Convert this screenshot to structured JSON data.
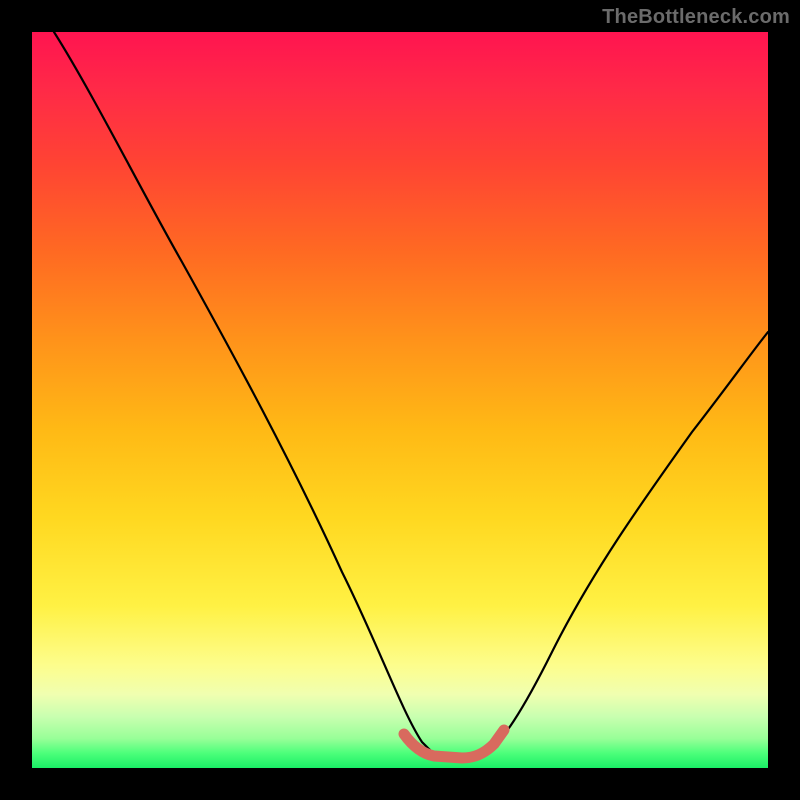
{
  "watermark": {
    "text": "TheBottleneck.com"
  },
  "colors": {
    "frame": "#000000",
    "line_black": "#000000",
    "thick_bottom": "#d86a5e"
  },
  "chart_data": {
    "type": "line",
    "title": "",
    "xlabel": "",
    "ylabel": "",
    "xlim": [
      0,
      100
    ],
    "ylim": [
      0,
      100
    ],
    "grid": false,
    "legend": false,
    "annotations": [],
    "series": [
      {
        "name": "bottleneck-curve",
        "x": [
          3,
          10,
          20,
          30,
          40,
          48,
          50,
          55,
          60,
          62,
          65,
          70,
          80,
          90,
          100
        ],
        "values": [
          100,
          90,
          73,
          55,
          37,
          18,
          10,
          2,
          2,
          2,
          5,
          12,
          25,
          40,
          55
        ]
      },
      {
        "name": "bottom-highlight",
        "x": [
          50,
          55,
          60,
          62
        ],
        "values": [
          2,
          2,
          2,
          3
        ]
      }
    ]
  }
}
